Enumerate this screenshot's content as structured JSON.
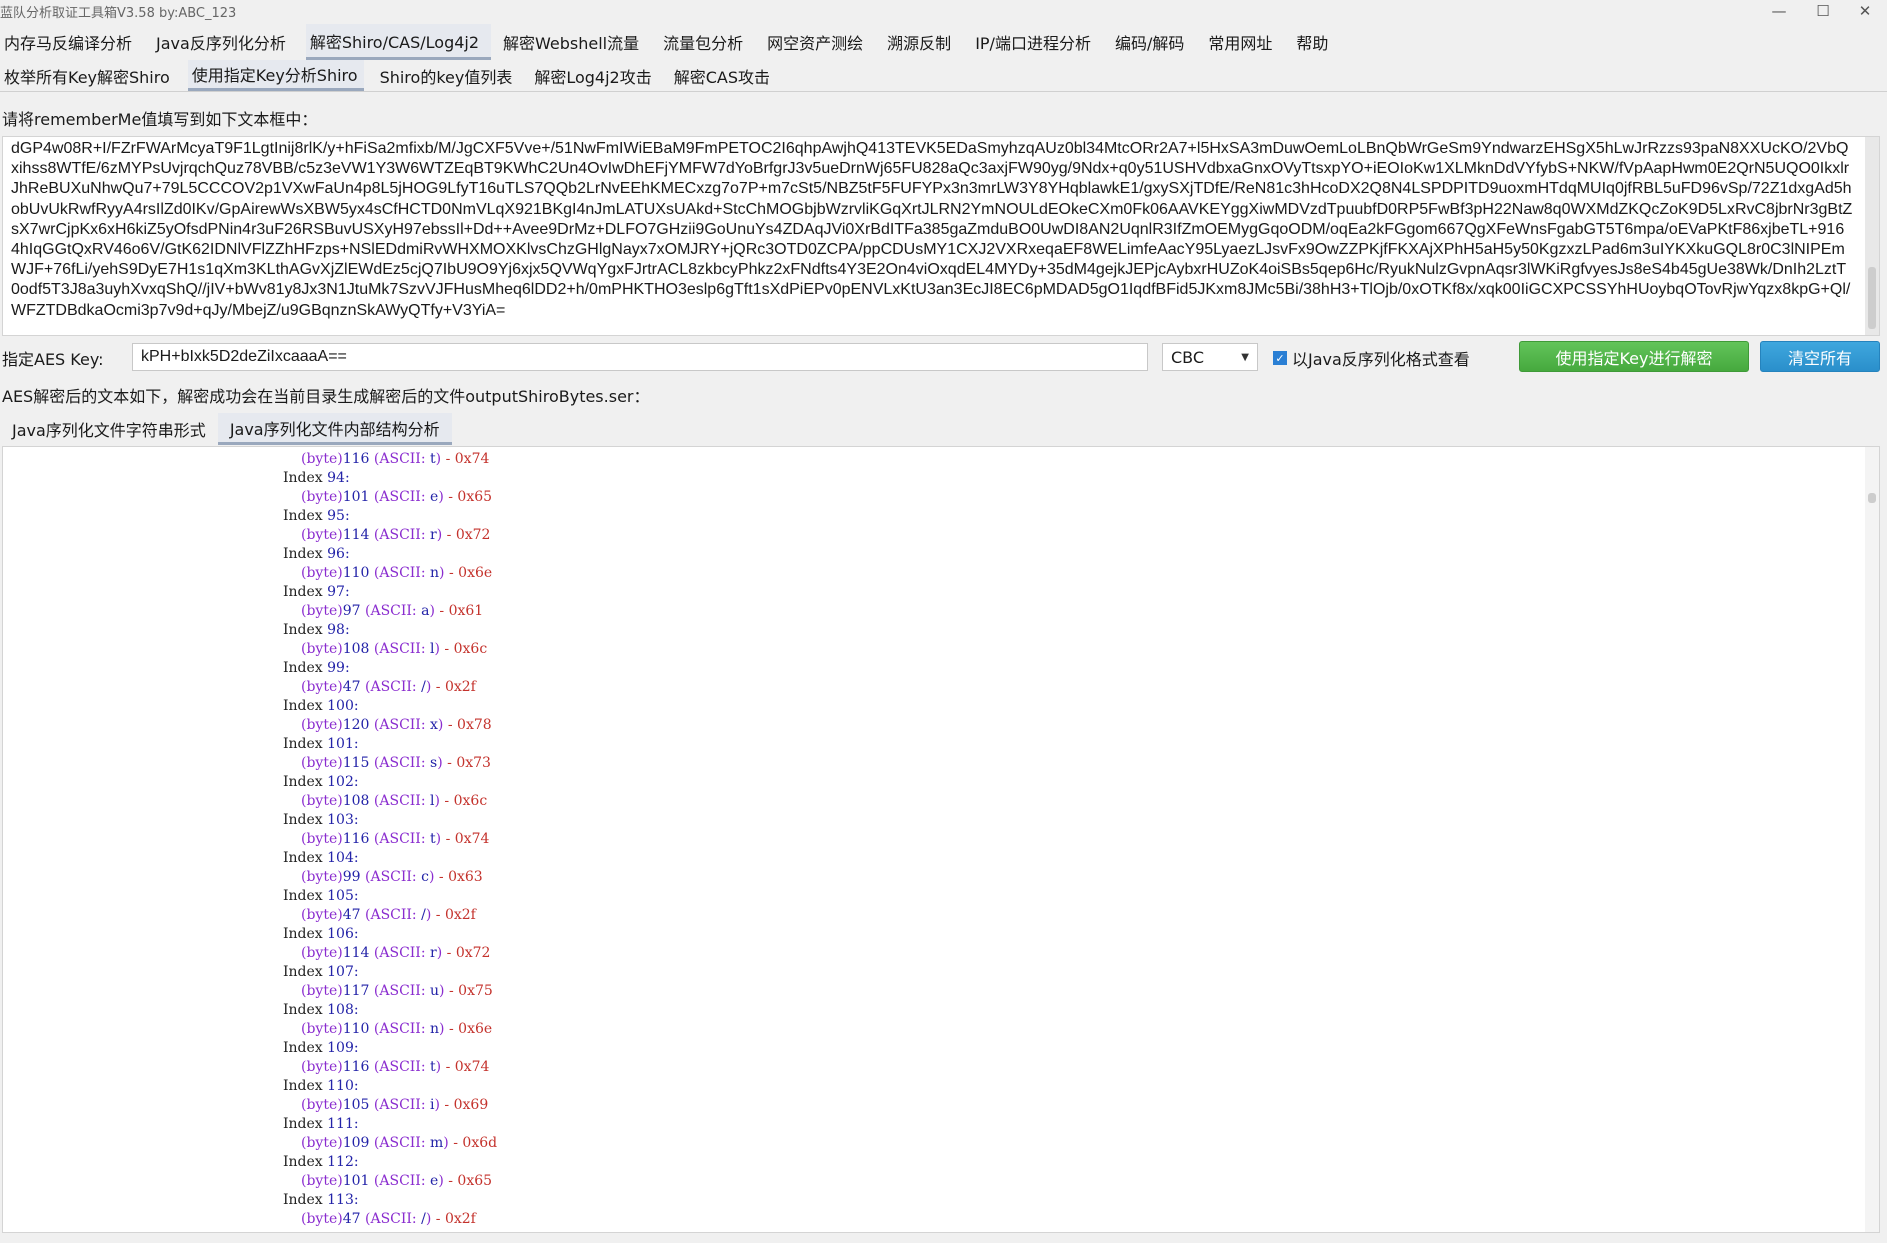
{
  "window": {
    "title": "蓝队分析取证工具箱V3.58 by:ABC_123",
    "minimize_glyph": "—",
    "maximize_glyph": "☐",
    "close_glyph": "✕"
  },
  "menu": [
    "内存马反编译分析",
    "Java反序列化分析",
    "解密Shiro/CAS/Log4j2",
    "解密Webshell流量",
    "流量包分析",
    "网空资产测绘",
    "溯源反制",
    "IP/端口进程分析",
    "编码/解码",
    "常用网址",
    "帮助"
  ],
  "menu_active_index": 2,
  "subtabs": [
    "枚举所有Key解密Shiro",
    "使用指定Key分析Shiro",
    "Shiro的key值列表",
    "解密Log4j2攻击",
    "解密CAS攻击"
  ],
  "subtab_active_index": 1,
  "prompt_label": "请将rememberMe值填写到如下文本框中：",
  "cookie_value": "dGP4w08R+I/FZrFWArMcyaT9F1LgtInij8rlK/y+hFiSa2mfixb/M/JgCXF5Vve+/51NwFmIWiEBaM9FmPETOC2I6qhpAwjhQ413TEVK5EDaSmyhzqAUz0bl34MtcORr2A7+l5HxSA3mDuwOemLoLBnQbWrGeSm9YndwarzEHSgX5hLwJrRzzs93paN8XXUcKO/2VbQxihss8WTfE/6zMYPsUvjrqchQuz78VBB/c5z3eVW1Y3W6WTZEqBT9KWhC2Un4OvIwDhEFjYMFW7dYoBrfgrJ3v5ueDrnWj65FU828aQc3axjFW90yg/9Ndx+q0y51USHVdbxaGnxOVyTtsxpYO+iEOIoKw1XLMknDdVYfybS+NKW/fVpAapHwm0E2QrN5UQO0IkxlrJhReBUXuNhwQu7+79L5CCCOV2p1VXwFaUn4p8L5jHOG9LfyT16uTLS7QQb2LrNvEEhKMECxzg7o7P+m7cSt5/NBZ5tF5FUFYPx3n3mrLW3Y8YHqblawkE1/gxySXjTDfE/ReN81c3hHcoDX2Q8N4LSPDPITD9uoxmHTdqMUIq0jfRBL5uFD96vSp/72Z1dxgAd5hobUvUkRwfRyyA4rsIlZd0IKv/GpAirewWsXBW5yx4sCfHCTD0NmVLqX921BKgI4nJmLATUXsUAkd+StcChMOGbjbWzrvliKGqXrtJLRN2YmNOULdEOkeCXm0Fk06AAVKEYggXiwMDVzdTpuubfD0RP5FwBf3pH22Naw8q0WXMdZKQcZoK9D5LxRvC8jbrNr3gBtZsX7wrCjpKx6xH6kiZ5yOfsdPNin4r3uF26RSBuvUSXyH97ebssIl+Dd++Avee9DrMz+DLFO7GHzii9GoUnuYs4ZDAqJVi0XrBdITFa385gaZmduBO0UwDI8AN2UqnlR3IfZmOEMygGqoODM/oqEa2kFGgom667QgXFeWnsFgabGT5T6mpa/oEVaPKtF86xjbeTL+9164hIqGGtQxRV46o6V/GtK62IDNlVFlZZhHFzps+NSlEDdmiRvWHXMOXKlvsChzGHlgNayx7xOMJRY+jQRc3OTD0ZCPA/ppCDUsMY1CXJ2VXRxeqaEF8WELimfeAacY95LyaezLJsvFx9OwZZPKjfFKXAjXPhH5aH5y50KgzxzLPad6m3uIYKXkuGQL8r0C3lNIPEmWJF+76fLi/yehS9DyE7H1s1qXm3KLthAGvXjZlEWdEz5cjQ7IbU9O9Yj6xjx5QVWqYgxFJrtrACL8zkbcyPhkz2xFNdfts4Y3E2On4viOxqdEL4MYDy+35dM4gejkJEPjcAybxrHUZoK4oiSBs5qep6Hc/RyukNulzGvpnAqsr3lWKiRgfvyesJs8eS4b45gUe38Wk/DnIh2LztT0odf5T3J8a3uyhXvxqShQ//jIV+bWv81y8Jx3N1JtuMk7SzvVJFHusMheq6lDD2+h/0mPHKTHO3eslp6gTft1sXdPiEPv0pENVLxKtU3an3EcJI8EC6pMDAD5gO1IqdfBFid5JKxm8JMc5Bi/38hH3+TlOjb/0xOTKf8x/xqk00IiGCXPCSSYhHUoybqOTovRjwYqzx8kpG+Ql/WFZTDBdkaOcmi3p7v9d+qJy/MbejZ/u9GBqnznSkAWyQTfy+V3YiA=",
  "aes_label": "指定AES Key:",
  "aes_key": "kPH+bIxk5D2deZiIxcaaaA==",
  "mode": "CBC",
  "java_view_label": "以Java反序列化格式查看",
  "java_view_checked": true,
  "decrypt_button": "使用指定Key进行解密",
  "clear_button": "清空所有",
  "result_label": "AES解密后的文本如下，解密成功会在当前目录生成解密后的文件outputShiroBytes.ser：",
  "result_tabs": [
    "Java序列化文件字符串形式",
    "Java序列化文件内部结构分析"
  ],
  "result_tab_active_index": 1,
  "struct_first_byte": {
    "value": "116",
    "char": "t",
    "hex": "0x74"
  },
  "struct_entries": [
    {
      "index": "94",
      "value": "101",
      "char": "e",
      "hex": "0x65"
    },
    {
      "index": "95",
      "value": "114",
      "char": "r",
      "hex": "0x72"
    },
    {
      "index": "96",
      "value": "110",
      "char": "n",
      "hex": "0x6e"
    },
    {
      "index": "97",
      "value": "97",
      "char": "a",
      "hex": "0x61"
    },
    {
      "index": "98",
      "value": "108",
      "char": "l",
      "hex": "0x6c"
    },
    {
      "index": "99",
      "value": "47",
      "char": "/",
      "hex": "0x2f"
    },
    {
      "index": "100",
      "value": "120",
      "char": "x",
      "hex": "0x78"
    },
    {
      "index": "101",
      "value": "115",
      "char": "s",
      "hex": "0x73"
    },
    {
      "index": "102",
      "value": "108",
      "char": "l",
      "hex": "0x6c"
    },
    {
      "index": "103",
      "value": "116",
      "char": "t",
      "hex": "0x74"
    },
    {
      "index": "104",
      "value": "99",
      "char": "c",
      "hex": "0x63"
    },
    {
      "index": "105",
      "value": "47",
      "char": "/",
      "hex": "0x2f"
    },
    {
      "index": "106",
      "value": "114",
      "char": "r",
      "hex": "0x72"
    },
    {
      "index": "107",
      "value": "117",
      "char": "u",
      "hex": "0x75"
    },
    {
      "index": "108",
      "value": "110",
      "char": "n",
      "hex": "0x6e"
    },
    {
      "index": "109",
      "value": "116",
      "char": "t",
      "hex": "0x74"
    },
    {
      "index": "110",
      "value": "105",
      "char": "i",
      "hex": "0x69"
    },
    {
      "index": "111",
      "value": "109",
      "char": "m",
      "hex": "0x6d"
    },
    {
      "index": "112",
      "value": "101",
      "char": "e",
      "hex": "0x65"
    },
    {
      "index": "113",
      "value": "47",
      "char": "/",
      "hex": "0x2f"
    }
  ]
}
